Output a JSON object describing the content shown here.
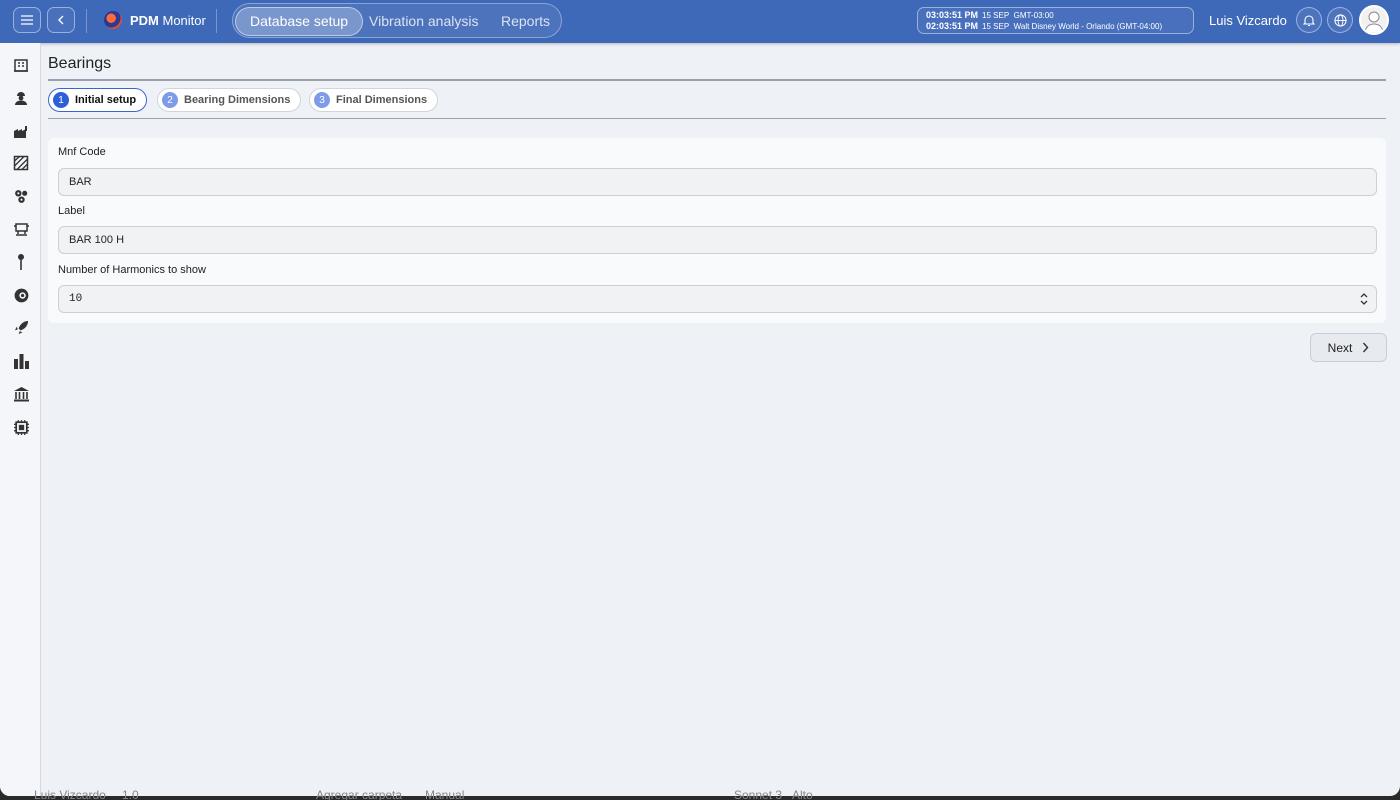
{
  "app": {
    "brand_bold": "PDM",
    "brand_rest": " Monitor"
  },
  "nav": {
    "tabs": [
      "Database setup",
      "Vibration analysis",
      "Reports"
    ],
    "active": 0
  },
  "clock": {
    "rows": [
      {
        "time": "03:03:51 PM",
        "date": "15 SEP",
        "zone": "GMT-03:00"
      },
      {
        "time": "02:03:51 PM",
        "date": "15 SEP",
        "zone": "Walt Disney World - Orlando (GMT-04:00)"
      }
    ]
  },
  "user": {
    "name": "Luis Vizcardo"
  },
  "sidebar": {
    "icons": [
      "building-icon",
      "worker-icon",
      "factory-icon",
      "area-icon",
      "gears-icon",
      "machine-icon",
      "pin-icon",
      "component-icon",
      "rocket-icon",
      "bar-chart-icon",
      "bank-icon",
      "chip-icon"
    ]
  },
  "page": {
    "title": "Bearings"
  },
  "steps": [
    {
      "num": "1",
      "label": "Initial setup",
      "active": true
    },
    {
      "num": "2",
      "label": "Bearing Dimensions",
      "active": false
    },
    {
      "num": "3",
      "label": "Final Dimensions",
      "active": false
    }
  ],
  "form": {
    "mnf_code": {
      "label": "Mnf Code",
      "value": "BAR"
    },
    "label": {
      "label": "Label",
      "value": "BAR 100 H"
    },
    "harmonics": {
      "label": "Number of Harmonics to show",
      "value": "10"
    }
  },
  "actions": {
    "next_label": "Next"
  },
  "background_strip": [
    "Luis Vizcardo",
    "1.0",
    "Agregar carpeta",
    "Manual",
    "Sonnet 3",
    "Alto"
  ],
  "colors": {
    "topbar": "#3e68b8",
    "accent": "#2d5fd8",
    "page_bg": "#eef1f6"
  }
}
